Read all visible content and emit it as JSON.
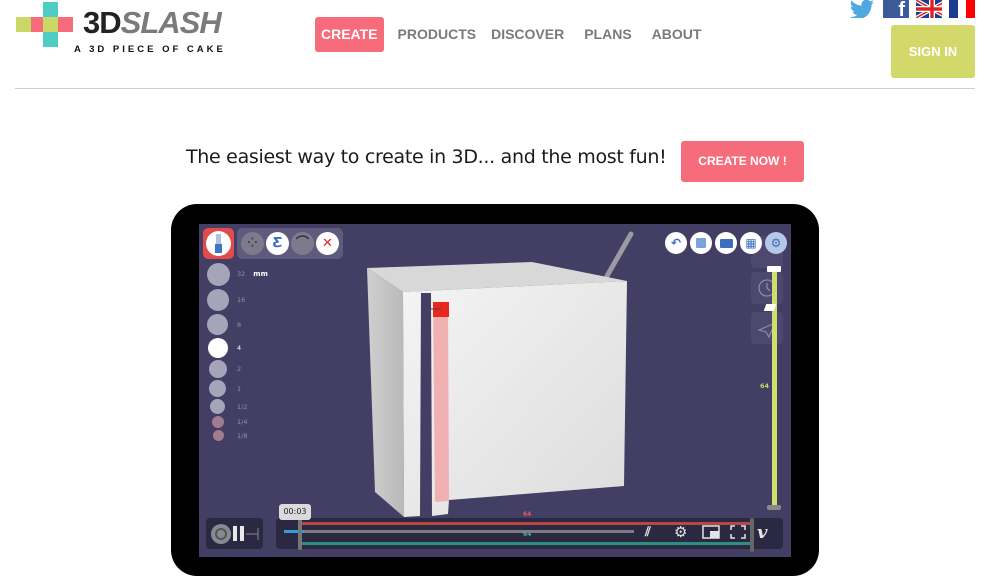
{
  "brand": {
    "name_part1": "3D",
    "name_part2": "SLASH",
    "tagline": "A 3D PIECE OF CAKE",
    "colors": {
      "green": "#c9d866",
      "pink": "#f66c7a",
      "teal": "#4ecdc4"
    }
  },
  "nav": {
    "items": [
      {
        "label": "CREATE",
        "active": true
      },
      {
        "label": "PRODUCTS"
      },
      {
        "label": "DISCOVER"
      },
      {
        "label": "PLANS"
      },
      {
        "label": "ABOUT"
      }
    ]
  },
  "social": {
    "icons": [
      "twitter-icon",
      "facebook-icon",
      "flag-uk-icon",
      "flag-fr-icon"
    ]
  },
  "header": {
    "signin_label": "SIGN IN"
  },
  "hero": {
    "tagline": "The easiest way to create in 3D... and the most fun!",
    "cta_label": "CREATE NOW !",
    "cta_color": "#f66c7a"
  },
  "app": {
    "tools": {
      "active_tool": "chisel",
      "tray": [
        "scatter-tool",
        "zigzag-tool",
        "curve-tool",
        "close"
      ]
    },
    "sizes": {
      "unit": "mm",
      "options": [
        "32",
        "16",
        "8",
        "4",
        "2",
        "1",
        "1/2",
        "1/4",
        "1/8"
      ],
      "selected": "4"
    },
    "top_icons": [
      "undo-icon",
      "save-icon",
      "open-folder-icon",
      "grid-icon",
      "settings-icon"
    ],
    "ruler": {
      "label": "64"
    },
    "axis_labels": {
      "red": "64",
      "gray": "64"
    }
  },
  "video": {
    "time": "00:03",
    "progress": 0.03
  }
}
